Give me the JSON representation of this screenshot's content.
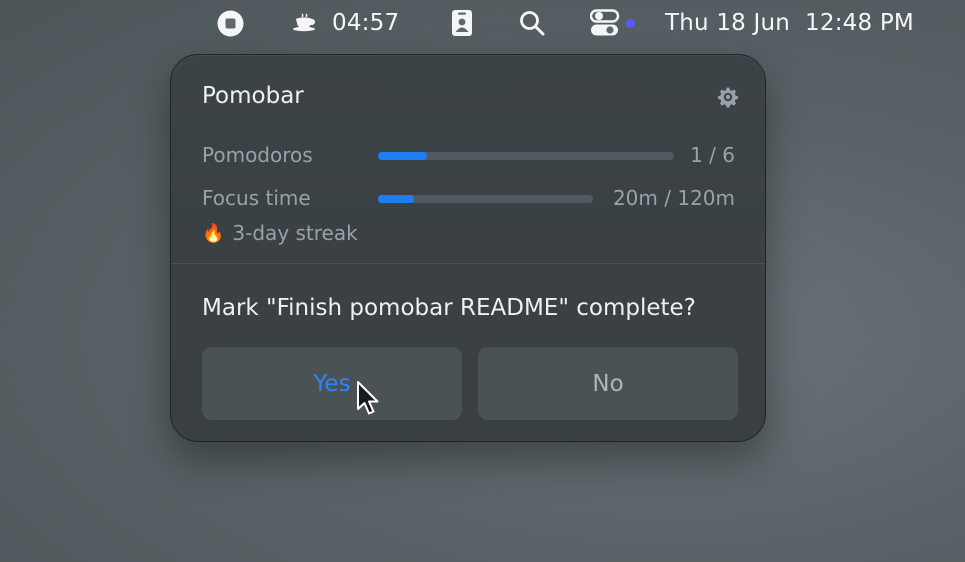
{
  "menubar": {
    "timer": "04:57",
    "datetime": "Thu 18 Jun  12:48 PM",
    "icons": [
      "stop-icon",
      "coffee-cup-icon",
      "id-badge-icon",
      "search-icon",
      "control-center-icon",
      "status-dot-icon"
    ],
    "dot_color": "#5b57ff"
  },
  "popover": {
    "title": "Pomobar",
    "stats": [
      {
        "label": "Pomodoros",
        "value_text": "1 / 6",
        "progress": 0.167
      },
      {
        "label": "Focus time",
        "value_text": "20m / 120m",
        "progress": 0.167
      }
    ],
    "streak": {
      "emoji": "🔥",
      "text": "3-day streak"
    },
    "question": "Mark \"Finish pomobar README\" complete?",
    "buttons": {
      "yes": "Yes",
      "no": "No"
    },
    "accent_color": "#1f7ef2"
  }
}
